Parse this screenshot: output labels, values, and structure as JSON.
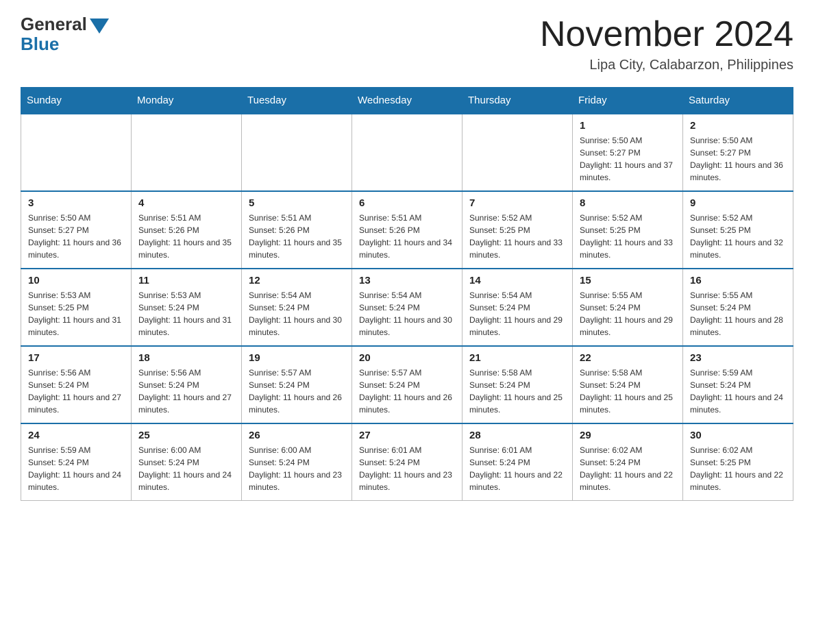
{
  "header": {
    "logo_general": "General",
    "logo_blue": "Blue",
    "month_year": "November 2024",
    "location": "Lipa City, Calabarzon, Philippines"
  },
  "weekdays": [
    "Sunday",
    "Monday",
    "Tuesday",
    "Wednesday",
    "Thursday",
    "Friday",
    "Saturday"
  ],
  "weeks": [
    [
      {
        "day": "",
        "info": ""
      },
      {
        "day": "",
        "info": ""
      },
      {
        "day": "",
        "info": ""
      },
      {
        "day": "",
        "info": ""
      },
      {
        "day": "",
        "info": ""
      },
      {
        "day": "1",
        "info": "Sunrise: 5:50 AM\nSunset: 5:27 PM\nDaylight: 11 hours and 37 minutes."
      },
      {
        "day": "2",
        "info": "Sunrise: 5:50 AM\nSunset: 5:27 PM\nDaylight: 11 hours and 36 minutes."
      }
    ],
    [
      {
        "day": "3",
        "info": "Sunrise: 5:50 AM\nSunset: 5:27 PM\nDaylight: 11 hours and 36 minutes."
      },
      {
        "day": "4",
        "info": "Sunrise: 5:51 AM\nSunset: 5:26 PM\nDaylight: 11 hours and 35 minutes."
      },
      {
        "day": "5",
        "info": "Sunrise: 5:51 AM\nSunset: 5:26 PM\nDaylight: 11 hours and 35 minutes."
      },
      {
        "day": "6",
        "info": "Sunrise: 5:51 AM\nSunset: 5:26 PM\nDaylight: 11 hours and 34 minutes."
      },
      {
        "day": "7",
        "info": "Sunrise: 5:52 AM\nSunset: 5:25 PM\nDaylight: 11 hours and 33 minutes."
      },
      {
        "day": "8",
        "info": "Sunrise: 5:52 AM\nSunset: 5:25 PM\nDaylight: 11 hours and 33 minutes."
      },
      {
        "day": "9",
        "info": "Sunrise: 5:52 AM\nSunset: 5:25 PM\nDaylight: 11 hours and 32 minutes."
      }
    ],
    [
      {
        "day": "10",
        "info": "Sunrise: 5:53 AM\nSunset: 5:25 PM\nDaylight: 11 hours and 31 minutes."
      },
      {
        "day": "11",
        "info": "Sunrise: 5:53 AM\nSunset: 5:24 PM\nDaylight: 11 hours and 31 minutes."
      },
      {
        "day": "12",
        "info": "Sunrise: 5:54 AM\nSunset: 5:24 PM\nDaylight: 11 hours and 30 minutes."
      },
      {
        "day": "13",
        "info": "Sunrise: 5:54 AM\nSunset: 5:24 PM\nDaylight: 11 hours and 30 minutes."
      },
      {
        "day": "14",
        "info": "Sunrise: 5:54 AM\nSunset: 5:24 PM\nDaylight: 11 hours and 29 minutes."
      },
      {
        "day": "15",
        "info": "Sunrise: 5:55 AM\nSunset: 5:24 PM\nDaylight: 11 hours and 29 minutes."
      },
      {
        "day": "16",
        "info": "Sunrise: 5:55 AM\nSunset: 5:24 PM\nDaylight: 11 hours and 28 minutes."
      }
    ],
    [
      {
        "day": "17",
        "info": "Sunrise: 5:56 AM\nSunset: 5:24 PM\nDaylight: 11 hours and 27 minutes."
      },
      {
        "day": "18",
        "info": "Sunrise: 5:56 AM\nSunset: 5:24 PM\nDaylight: 11 hours and 27 minutes."
      },
      {
        "day": "19",
        "info": "Sunrise: 5:57 AM\nSunset: 5:24 PM\nDaylight: 11 hours and 26 minutes."
      },
      {
        "day": "20",
        "info": "Sunrise: 5:57 AM\nSunset: 5:24 PM\nDaylight: 11 hours and 26 minutes."
      },
      {
        "day": "21",
        "info": "Sunrise: 5:58 AM\nSunset: 5:24 PM\nDaylight: 11 hours and 25 minutes."
      },
      {
        "day": "22",
        "info": "Sunrise: 5:58 AM\nSunset: 5:24 PM\nDaylight: 11 hours and 25 minutes."
      },
      {
        "day": "23",
        "info": "Sunrise: 5:59 AM\nSunset: 5:24 PM\nDaylight: 11 hours and 24 minutes."
      }
    ],
    [
      {
        "day": "24",
        "info": "Sunrise: 5:59 AM\nSunset: 5:24 PM\nDaylight: 11 hours and 24 minutes."
      },
      {
        "day": "25",
        "info": "Sunrise: 6:00 AM\nSunset: 5:24 PM\nDaylight: 11 hours and 24 minutes."
      },
      {
        "day": "26",
        "info": "Sunrise: 6:00 AM\nSunset: 5:24 PM\nDaylight: 11 hours and 23 minutes."
      },
      {
        "day": "27",
        "info": "Sunrise: 6:01 AM\nSunset: 5:24 PM\nDaylight: 11 hours and 23 minutes."
      },
      {
        "day": "28",
        "info": "Sunrise: 6:01 AM\nSunset: 5:24 PM\nDaylight: 11 hours and 22 minutes."
      },
      {
        "day": "29",
        "info": "Sunrise: 6:02 AM\nSunset: 5:24 PM\nDaylight: 11 hours and 22 minutes."
      },
      {
        "day": "30",
        "info": "Sunrise: 6:02 AM\nSunset: 5:25 PM\nDaylight: 11 hours and 22 minutes."
      }
    ]
  ]
}
